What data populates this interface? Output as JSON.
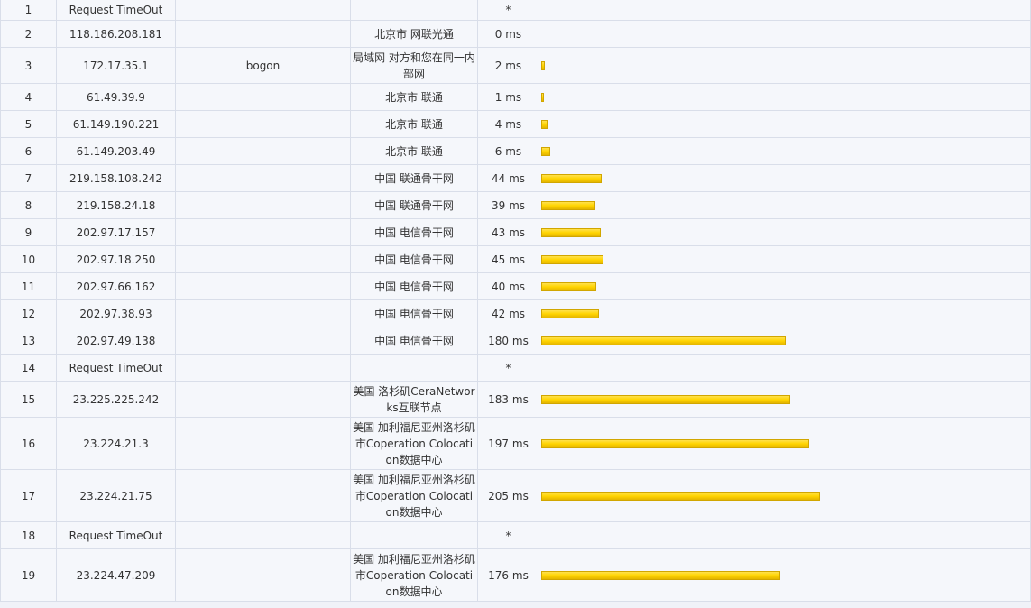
{
  "hops": [
    {
      "no": "1",
      "ip": "Request TimeOut",
      "host": "",
      "geo": "",
      "latency": "*",
      "ms": 0
    },
    {
      "no": "2",
      "ip": "118.186.208.181",
      "host": "",
      "geo": "北京市 网联光通",
      "latency": "0 ms",
      "ms": 0
    },
    {
      "no": "3",
      "ip": "172.17.35.1",
      "host": "bogon",
      "geo": "局域网 对方和您在同一内部网",
      "latency": "2 ms",
      "ms": 2
    },
    {
      "no": "4",
      "ip": "61.49.39.9",
      "host": "",
      "geo": "北京市 联通",
      "latency": "1 ms",
      "ms": 1
    },
    {
      "no": "5",
      "ip": "61.149.190.221",
      "host": "",
      "geo": "北京市 联通",
      "latency": "4 ms",
      "ms": 4
    },
    {
      "no": "6",
      "ip": "61.149.203.49",
      "host": "",
      "geo": "北京市 联通",
      "latency": "6 ms",
      "ms": 6
    },
    {
      "no": "7",
      "ip": "219.158.108.242",
      "host": "",
      "geo": "中国 联通骨干网",
      "latency": "44 ms",
      "ms": 44
    },
    {
      "no": "8",
      "ip": "219.158.24.18",
      "host": "",
      "geo": "中国 联通骨干网",
      "latency": "39 ms",
      "ms": 39
    },
    {
      "no": "9",
      "ip": "202.97.17.157",
      "host": "",
      "geo": "中国 电信骨干网",
      "latency": "43 ms",
      "ms": 43
    },
    {
      "no": "10",
      "ip": "202.97.18.250",
      "host": "",
      "geo": "中国 电信骨干网",
      "latency": "45 ms",
      "ms": 45
    },
    {
      "no": "11",
      "ip": "202.97.66.162",
      "host": "",
      "geo": "中国 电信骨干网",
      "latency": "40 ms",
      "ms": 40
    },
    {
      "no": "12",
      "ip": "202.97.38.93",
      "host": "",
      "geo": "中国 电信骨干网",
      "latency": "42 ms",
      "ms": 42
    },
    {
      "no": "13",
      "ip": "202.97.49.138",
      "host": "",
      "geo": "中国 电信骨干网",
      "latency": "180 ms",
      "ms": 180
    },
    {
      "no": "14",
      "ip": "Request TimeOut",
      "host": "",
      "geo": "",
      "latency": "*",
      "ms": 0
    },
    {
      "no": "15",
      "ip": "23.225.225.242",
      "host": "",
      "geo": "美国 洛杉矶CeraNetworks互联节点",
      "latency": "183 ms",
      "ms": 183
    },
    {
      "no": "16",
      "ip": "23.224.21.3",
      "host": "",
      "geo": "美国 加利福尼亚州洛杉矶市Coperation Colocation数据中心",
      "latency": "197 ms",
      "ms": 197
    },
    {
      "no": "17",
      "ip": "23.224.21.75",
      "host": "",
      "geo": "美国 加利福尼亚州洛杉矶市Coperation Colocation数据中心",
      "latency": "205 ms",
      "ms": 205
    },
    {
      "no": "18",
      "ip": "Request TimeOut",
      "host": "",
      "geo": "",
      "latency": "*",
      "ms": 0
    },
    {
      "no": "19",
      "ip": "23.224.47.209",
      "host": "",
      "geo": "美国 加利福尼亚州洛杉矶市Coperation Colocation数据中心",
      "latency": "176 ms",
      "ms": 176
    }
  ],
  "colors": {
    "bar_fill": "#ffd400",
    "bar_border": "#d1a600",
    "cell_bg": "#f5f7fb",
    "grid_line": "#d9dee9"
  }
}
